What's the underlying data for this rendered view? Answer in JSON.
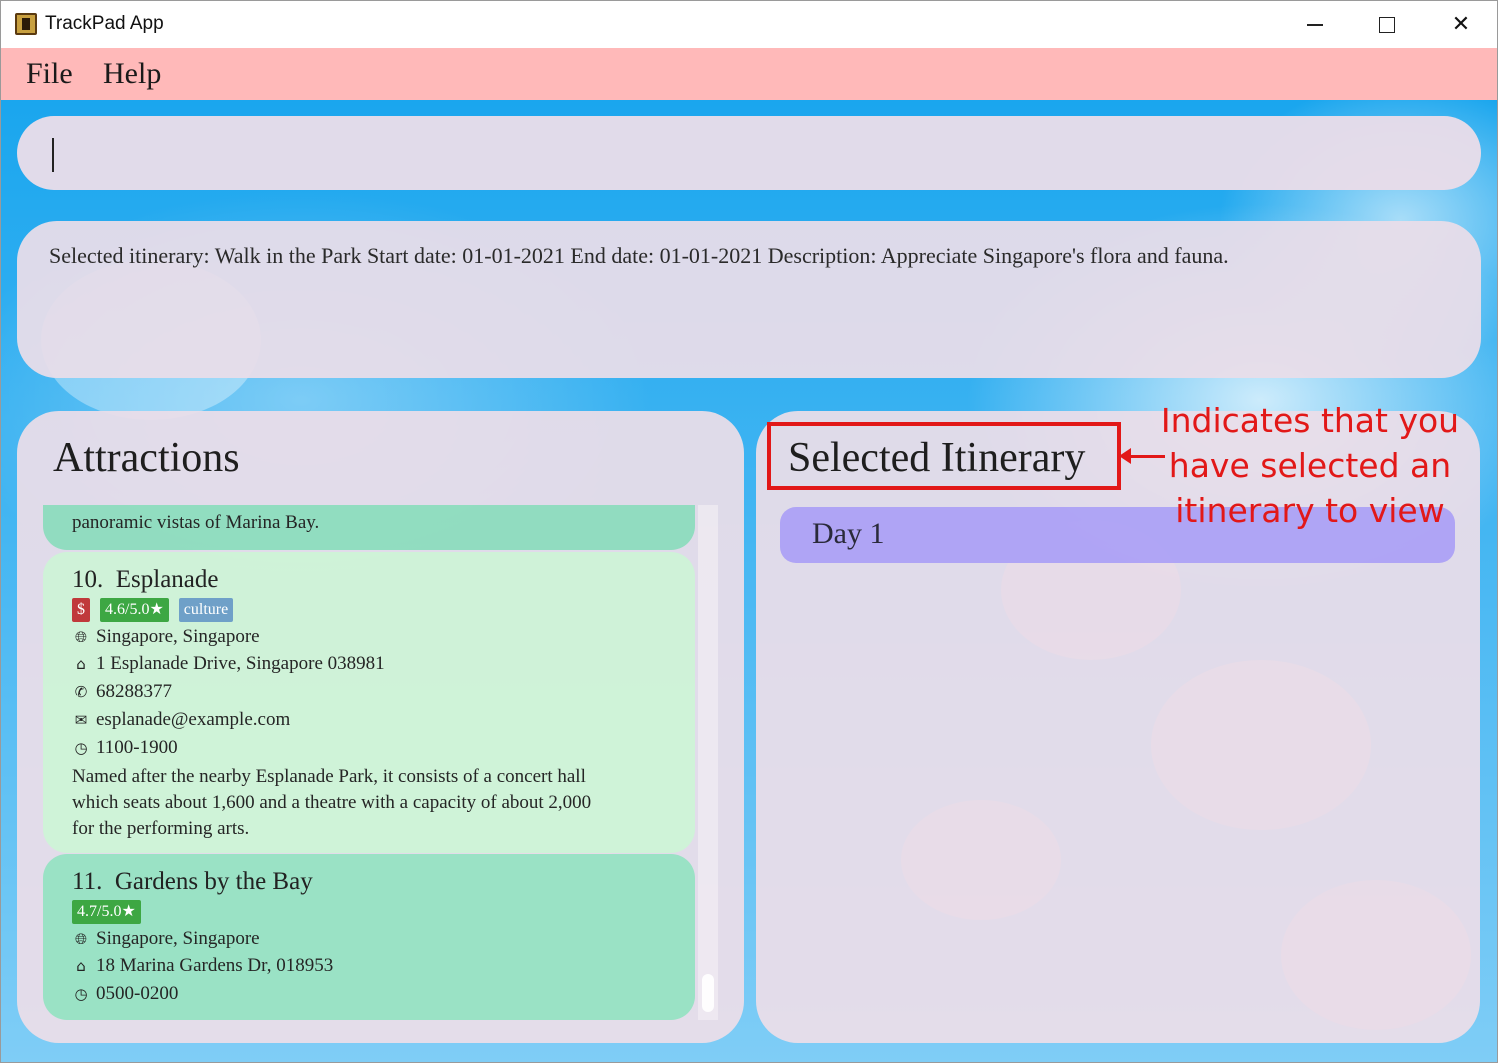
{
  "window": {
    "title": "TrackPad App",
    "controls": {
      "minimize": "minimize-icon",
      "maximize": "maximize-icon",
      "close": "close-icon"
    }
  },
  "menu": {
    "file": "File",
    "help": "Help"
  },
  "command": {
    "value": ""
  },
  "result": {
    "text": "Selected itinerary: Walk in the Park Start date: 01-01-2021 End date: 01-01-2021 Description: Appreciate Singapore's flora and fauna."
  },
  "attractions": {
    "title": "Attractions",
    "partial_card": {
      "description_tail": "panoramic vistas of Marina Bay."
    },
    "esplanade": {
      "index": "10.",
      "name": "Esplanade",
      "price": "$",
      "rating": "4.6/5.0★",
      "tag": "culture",
      "location": "Singapore, Singapore",
      "address": "1 Esplanade Drive, Singapore 038981",
      "phone": "68288377",
      "email": "esplanade@example.com",
      "hours": "1100-1900",
      "desc_line1": "Named after the nearby Esplanade Park, it consists of a concert hall",
      "desc_line2": "which seats about 1,600 and a theatre with a capacity of about 2,000",
      "desc_line3": "for the performing arts."
    },
    "gardens": {
      "index": "11.",
      "name": "Gardens by the Bay",
      "rating": "4.7/5.0★",
      "location": "Singapore, Singapore",
      "address": "18 Marina Gardens Dr, 018953",
      "hours": "0500-0200"
    }
  },
  "itinerary": {
    "title": "Selected Itinerary",
    "days": [
      "Day 1"
    ]
  },
  "annotation": {
    "line1": "Indicates that you",
    "line2": "have selected an",
    "line3": "itinerary to view",
    "color": "#e21818"
  },
  "icons": {
    "globe": "globe-icon",
    "home": "home-icon",
    "phone": "phone-icon",
    "email": "email-icon",
    "clock": "clock-icon"
  }
}
